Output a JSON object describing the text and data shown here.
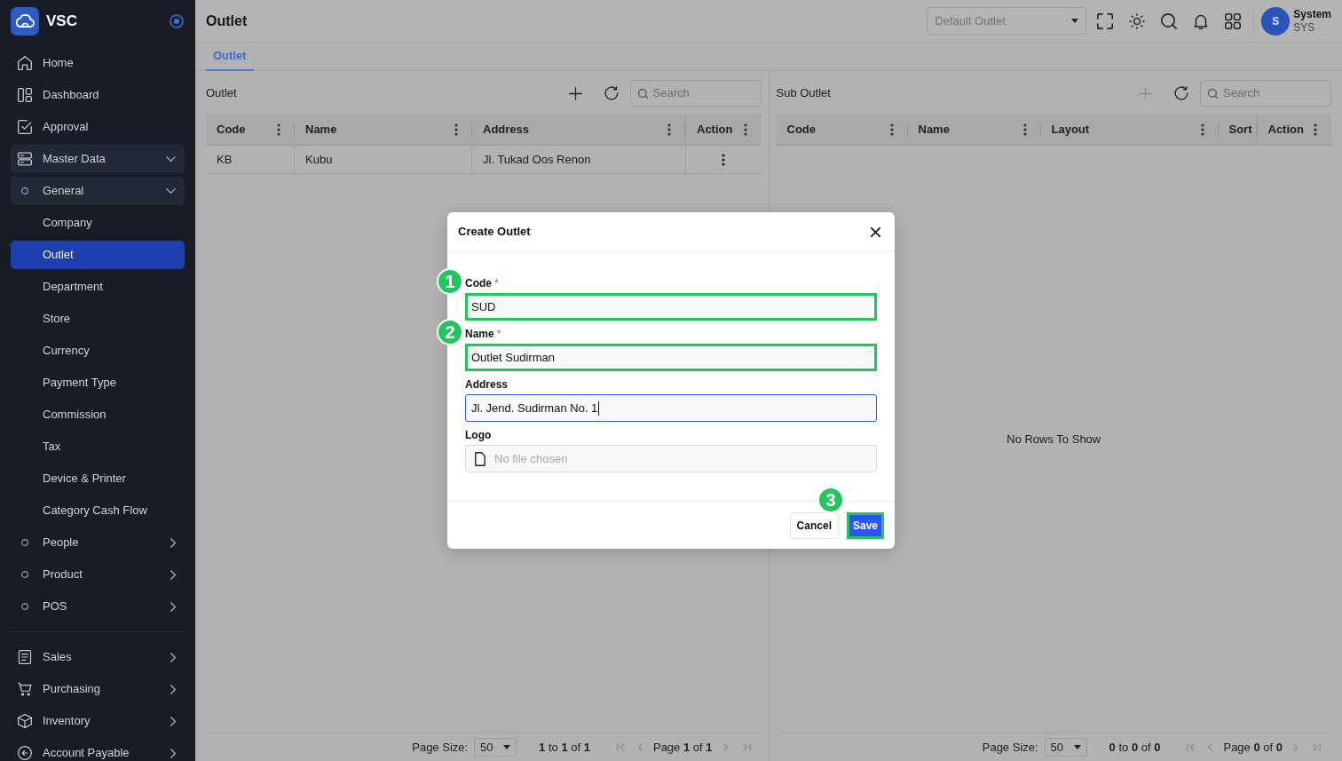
{
  "sidebar": {
    "brand": "VSC",
    "sections": [
      {
        "items": [
          {
            "label": "Home",
            "selected": false
          },
          {
            "label": "Dashboard",
            "selected": false
          },
          {
            "label": "Approval",
            "selected": false
          },
          {
            "label": "Master Data",
            "expanded": true,
            "children": [
              {
                "label": "General",
                "expanded": true,
                "children": [
                  {
                    "label": "Company",
                    "selected": false
                  },
                  {
                    "label": "Outlet",
                    "selected": true
                  },
                  {
                    "label": "Department",
                    "selected": false
                  },
                  {
                    "label": "Store",
                    "selected": false
                  },
                  {
                    "label": "Currency",
                    "selected": false
                  },
                  {
                    "label": "Payment Type",
                    "selected": false
                  },
                  {
                    "label": "Commission",
                    "selected": false
                  },
                  {
                    "label": "Tax",
                    "selected": false
                  },
                  {
                    "label": "Device & Printer",
                    "selected": false
                  },
                  {
                    "label": "Category Cash Flow",
                    "selected": false
                  }
                ]
              },
              {
                "label": "People",
                "expanded": false
              },
              {
                "label": "Product",
                "expanded": false
              },
              {
                "label": "POS",
                "expanded": false
              }
            ]
          }
        ]
      },
      {
        "items": [
          {
            "label": "Sales",
            "expanded": false
          },
          {
            "label": "Purchasing",
            "expanded": false
          },
          {
            "label": "Inventory",
            "expanded": false
          },
          {
            "label": "Account Payable",
            "expanded": false
          }
        ]
      }
    ]
  },
  "header": {
    "title": "Outlet",
    "outlet_select": {
      "placeholder": "Default Outlet"
    },
    "user": {
      "initial": "S",
      "name": "System",
      "code": "SYS"
    }
  },
  "tabs": [
    {
      "label": "Outlet",
      "selected": true
    }
  ],
  "panels": [
    {
      "title": "Outlet",
      "add_disabled": false,
      "search": {
        "placeholder": "Search"
      },
      "table": {
        "columns": [
          {
            "label": "Code",
            "kind": "data"
          },
          {
            "label": "Name",
            "kind": "data"
          },
          {
            "label": "Address",
            "kind": "data"
          },
          {
            "label": "Action",
            "kind": "action"
          }
        ],
        "rows": [
          {
            "cells": [
              "KB",
              "Kubu",
              "Jl. Tukad Oos Renon"
            ]
          }
        ]
      },
      "pager": {
        "page_size_label": "Page Size:",
        "page_size": "50",
        "range": "**1** to **1** of **1**",
        "page": "Page **1** of **1**"
      }
    },
    {
      "title": "Sub Outlet",
      "add_disabled": true,
      "search": {
        "placeholder": "Search"
      },
      "table": {
        "columns": [
          {
            "label": "Code",
            "kind": "data"
          },
          {
            "label": "Name",
            "kind": "data"
          },
          {
            "label": "Layout",
            "kind": "data"
          },
          {
            "label": "Sort",
            "kind": "data"
          },
          {
            "label": "Action",
            "kind": "action"
          }
        ],
        "empty_message": "No Rows To Show"
      },
      "pager": {
        "page_size_label": "Page Size:",
        "page_size": "50",
        "range": "**0** to **0** of **0**",
        "page": "Page **0** of **0**"
      }
    }
  ],
  "dialog": {
    "title": "Create Outlet",
    "fields": [
      {
        "kind": "text",
        "label": "Code",
        "required_mark": "*",
        "value": "SUD",
        "focused": false,
        "highlighted": true,
        "step": "1"
      },
      {
        "kind": "text",
        "label": "Name",
        "required_mark": "*",
        "value": "Outlet Sudirman",
        "focused": false,
        "highlighted": true,
        "step": "2"
      },
      {
        "kind": "text",
        "label": "Address",
        "value": "Jl. Jend. Sudirman No. 1",
        "focused": true,
        "highlighted": false
      },
      {
        "kind": "file",
        "label": "Logo",
        "placeholder": "No file chosen",
        "focused": false,
        "highlighted": false
      }
    ],
    "buttons": [
      {
        "label": "Cancel",
        "kind": "secondary",
        "highlighted": false
      },
      {
        "label": "Save",
        "kind": "primary",
        "highlighted": true,
        "step": "3"
      }
    ]
  }
}
